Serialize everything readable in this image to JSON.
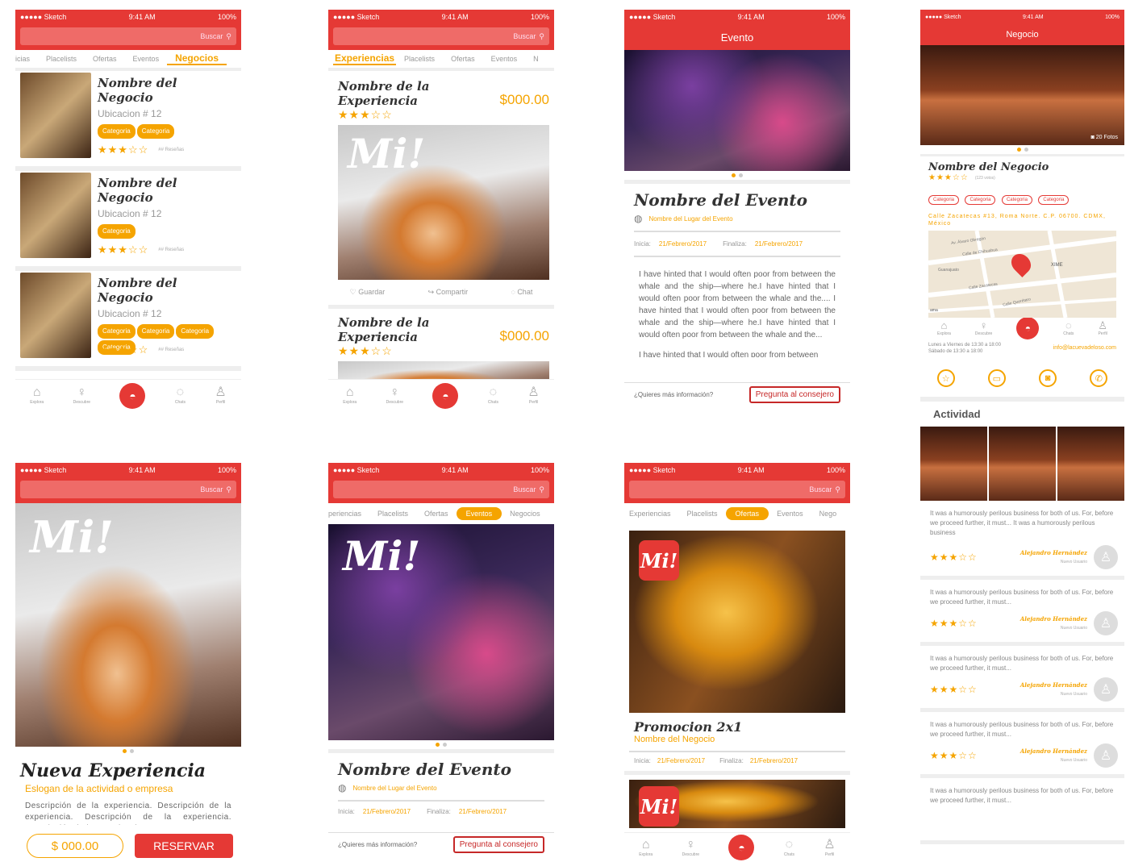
{
  "status": {
    "carrier": "●●●●● Sketch",
    "time": "9:41 AM",
    "battery": "100%"
  },
  "search_placeholder": "Buscar",
  "nav": {
    "items": [
      "Explora",
      "Descubre",
      "Chats",
      "Perfil"
    ]
  },
  "tabs": [
    "Experiencias",
    "Placelists",
    "Ofertas",
    "Eventos",
    "Negocios"
  ],
  "s1": {
    "tabs_visible": [
      "icias",
      "Placelists",
      "Ofertas",
      "Eventos",
      "Negocios"
    ],
    "items": [
      {
        "name": "Nombre del Negocio",
        "location": "Ubicacion # 12",
        "cats": [
          "Categoria",
          "Categoria"
        ],
        "reviews": "## Reseñas",
        "stars": "★★★☆☆"
      },
      {
        "name": "Nombre del Negocio",
        "location": "Ubicacion # 12",
        "cats": [
          "Categoria"
        ],
        "reviews": "## Reseñas",
        "stars": "★★★☆☆"
      },
      {
        "name": "Nombre del Negocio",
        "location": "Ubicacion # 12",
        "cats": [
          "Categoria",
          "Categoria",
          "Categoria",
          "Categoria"
        ],
        "reviews": "## Reseñas",
        "stars": "★★★☆☆"
      }
    ]
  },
  "s2": {
    "tabs_visible": [
      "Experiencias",
      "Placelists",
      "Ofertas",
      "Eventos",
      "N"
    ],
    "name": "Nombre de la Experiencia",
    "price": "$000.00",
    "stars": "★★★☆☆",
    "logo": "Mi!",
    "actions": [
      "Guardar",
      "Compartir",
      "Chat"
    ]
  },
  "s3": {
    "title": "Evento",
    "event": "Nombre del Evento",
    "venue": "Nombre del Lugar del Evento",
    "start_label": "Inicia:",
    "start": "21/Febrero/2017",
    "end_label": "Finaliza:",
    "end": "21/Febrero/2017",
    "para": "I have hinted that I would often poor from between the whale and the ship—where he.I have hinted that I would often poor from between the whale and the.... I have hinted that I would often poor from between the whale and the ship—where he.I have hinted that I would often poor from between the whale and the...",
    "para2": "I have hinted that I would often poor from between",
    "question": "¿Quieres más información?",
    "ask": "Pregunta al consejero"
  },
  "s4": {
    "title": "Negocio",
    "photos": "20 Fotos",
    "name": "Nombre del Negocio",
    "votes": "(123 votos)",
    "stars": "★★★☆☆",
    "cats": [
      "Categoria",
      "Categoria",
      "Categoria",
      "Categoria"
    ],
    "address": "Calle Zacatecas #13, Roma Norte. C.P. 06700. CDMX, México",
    "map_labels": [
      "Av. Álvaro Obregón",
      "Calle de Chihuahua",
      "Guanajuato",
      "Calle Zacatecas",
      "Calle Querétaro",
      "XIME",
      "ama"
    ],
    "hours": "Lunes a Viernes de 13:30 a 18:00\nSábado de 13:30 a 18:00",
    "email": "info@lacuevadeloso.com",
    "activity_title": "Actividad",
    "reviews": [
      {
        "text": "It was a humorously perilous business for both of us. For, before we proceed further, it must... It was a humorously perilous business",
        "author": "Alejandro Hernández",
        "sub": "Nuevo Usuario",
        "stars": "★★★☆☆"
      },
      {
        "text": "It was a humorously perilous business for both of us. For, before we proceed further, it must...",
        "author": "Alejandro Hernández",
        "sub": "Nuevo Usuario",
        "stars": "★★★☆☆"
      },
      {
        "text": "It was a humorously perilous business for both of us. For, before we proceed further, it must...",
        "author": "Alejandro Hernández",
        "sub": "Nuevo Usuario",
        "stars": "★★★☆☆"
      },
      {
        "text": "It was a humorously perilous business for both of us. For, before we proceed further, it must...",
        "author": "Alejandro Hernández",
        "sub": "Nuevo Usuario",
        "stars": "★★★☆☆"
      },
      {
        "text": "It was a humorously perilous business for both of us. For, before we proceed further, it must...",
        "author": "",
        "sub": "",
        "stars": ""
      }
    ]
  },
  "s5": {
    "logo": "Mi!",
    "title": "Nueva Experiencia",
    "slogan": "Eslogan de la actividad o empresa",
    "desc": "Descripción de la experiencia. Descripción de la experiencia. Descripción de la experiencia. Descripción de la experiencia.",
    "price": "$ 000.00",
    "reserve": "RESERVAR"
  },
  "s6": {
    "tabs_visible": [
      "periencias",
      "Placelists",
      "Ofertas",
      "Eventos",
      "Negocios"
    ],
    "logo": "Mi!",
    "event": "Nombre del Evento",
    "venue": "Nombre del Lugar del Evento",
    "start_label": "Inicia:",
    "start": "21/Febrero/2017",
    "end_label": "Finaliza:",
    "end": "21/Febrero/2017",
    "question": "¿Quieres más información?",
    "ask": "Pregunta al consejero"
  },
  "s7": {
    "tabs_visible": [
      "Experiencias",
      "Placelists",
      "Ofertas",
      "Eventos",
      "Nego"
    ],
    "logo": "Mi!",
    "promo": "Promocion 2x1",
    "business": "Nombre del Negocio",
    "start_label": "Inicia:",
    "start": "21/Febrero/2017",
    "end_label": "Finaliza:",
    "end": "21/Febrero/2017"
  },
  "colors": {
    "primary": "#e53935",
    "accent": "#f5a400"
  }
}
